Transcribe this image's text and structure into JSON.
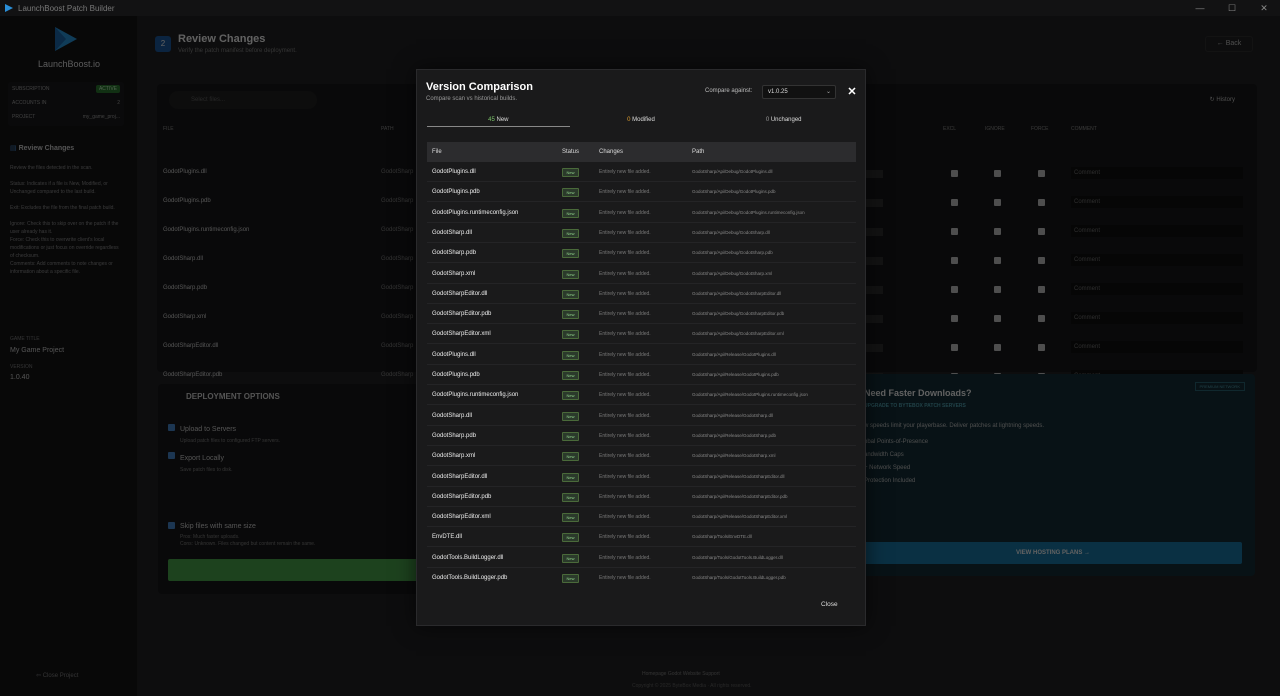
{
  "window": {
    "title": "LaunchBoost Patch Builder",
    "controls": [
      "—",
      "☐",
      "✕"
    ]
  },
  "sidebar": {
    "brand": "LaunchBoost.io",
    "subscription_label": "SUBSCRIPTION",
    "subscription_value": "ACTIVE",
    "accounts_label": "ACCOUNTS IN",
    "accounts_value": "2",
    "project_label": "PROJECT",
    "project_value": "my_game_proj...",
    "section": "Review Changes",
    "help_intro": "Review the files detected in the scan.",
    "help_status": "Status: Indicates if a file is New, Modified, or Unchanged compared to the last build.",
    "help_exit": "Exit: Excludes the file from the final patch build.",
    "help_ignore": "Ignore: Check this to skip over on the patch if the user already has it.",
    "help_force": "Force: Check this to overwrite client's local modifications or just focus on override regardless of checksum.",
    "help_comments": "Comments: Add comments to note changes or information about a specific file.",
    "game_title_label": "GAME TITLE",
    "game_title_value": "My Game Project",
    "version_label": "VERSION",
    "version_value": "1.0.40",
    "close_project": "Close Project"
  },
  "header": {
    "step": "2",
    "title": "Review Changes",
    "subtitle": "Verify the patch manifest before deployment.",
    "back": "Back"
  },
  "bg_table": {
    "search_placeholder": "Select files...",
    "history": "History",
    "col_file": "FILE",
    "col_path": "PATH",
    "col_excl": "EXCL",
    "col_ignore": "IGNORE",
    "col_force": "FORCE",
    "col_comment": "COMMENT",
    "comment_placeholder": "Comment",
    "rows": [
      {
        "file": "GodotPlugins.dll",
        "path": "GodotSharp"
      },
      {
        "file": "GodotPlugins.pdb",
        "path": "GodotSharp"
      },
      {
        "file": "GodotPlugins.runtimeconfig.json",
        "path": "GodotSharp"
      },
      {
        "file": "GodotSharp.dll",
        "path": "GodotSharp"
      },
      {
        "file": "GodotSharp.pdb",
        "path": "GodotSharp"
      },
      {
        "file": "GodotSharp.xml",
        "path": "GodotSharp"
      },
      {
        "file": "GodotSharpEditor.dll",
        "path": "GodotSharp"
      },
      {
        "file": "GodotSharpEditor.pdb",
        "path": "GodotSharp"
      }
    ]
  },
  "deploy": {
    "title": "DEPLOYMENT OPTIONS",
    "upload": "Upload to Servers",
    "upload_sub": "Upload patch files to configured FTP servers.",
    "export": "Export Locally",
    "export_sub": "Save patch files to disk.",
    "skip": "Skip files with same size",
    "skip_pros": "Pros: Much faster uploads.",
    "skip_cons": "Cons: Unknown. Files changed but content remain the same."
  },
  "promo": {
    "tag": "PREMIUM NETWORK",
    "title": "Need Faster Downloads?",
    "subtitle": "UPGRADE TO BYTEBOX PATCH SERVERS",
    "desc": "w speeds limit your playerbase. Deliver patches at lightning speeds.",
    "features": [
      "obal Points-of-Presence",
      "andwidth Caps",
      "+ Network Speed",
      "Protection Included"
    ],
    "button": "VIEW HOSTING PLANS"
  },
  "footer": {
    "links": "Homepage     Godot Website     Support",
    "copyright": "Copyright © 2025 ByteBox Media  ·  All rights reserved."
  },
  "modal": {
    "title": "Version Comparison",
    "subtitle": "Compare scan vs historical builds.",
    "compare_label": "Compare against:",
    "compare_value": "v1.0.25",
    "stats": {
      "new_count": "45",
      "new_label": "New",
      "mod_count": "0",
      "mod_label": "Modified",
      "unc_count": "0",
      "unc_label": "Unchanged"
    },
    "columns": {
      "file": "File",
      "status": "Status",
      "changes": "Changes",
      "path": "Path"
    },
    "close": "Close",
    "rows": [
      {
        "file": "GodotPlugins.dll",
        "status": "New",
        "changes": "Entirely new file added.",
        "path": "GodotSharp/Api/Debug/GodotPlugins.dll"
      },
      {
        "file": "GodotPlugins.pdb",
        "status": "New",
        "changes": "Entirely new file added.",
        "path": "GodotSharp/Api/Debug/GodotPlugins.pdb"
      },
      {
        "file": "GodotPlugins.runtimeconfig.json",
        "status": "New",
        "changes": "Entirely new file added.",
        "path": "GodotSharp/Api/Debug/GodotPlugins.runtimeconfig.json"
      },
      {
        "file": "GodotSharp.dll",
        "status": "New",
        "changes": "Entirely new file added.",
        "path": "GodotSharp/Api/Debug/GodotSharp.dll"
      },
      {
        "file": "GodotSharp.pdb",
        "status": "New",
        "changes": "Entirely new file added.",
        "path": "GodotSharp/Api/Debug/GodotSharp.pdb"
      },
      {
        "file": "GodotSharp.xml",
        "status": "New",
        "changes": "Entirely new file added.",
        "path": "GodotSharp/Api/Debug/GodotSharp.xml"
      },
      {
        "file": "GodotSharpEditor.dll",
        "status": "New",
        "changes": "Entirely new file added.",
        "path": "GodotSharp/Api/Debug/GodotSharpEditor.dll"
      },
      {
        "file": "GodotSharpEditor.pdb",
        "status": "New",
        "changes": "Entirely new file added.",
        "path": "GodotSharp/Api/Debug/GodotSharpEditor.pdb"
      },
      {
        "file": "GodotSharpEditor.xml",
        "status": "New",
        "changes": "Entirely new file added.",
        "path": "GodotSharp/Api/Debug/GodotSharpEditor.xml"
      },
      {
        "file": "GodotPlugins.dll",
        "status": "New",
        "changes": "Entirely new file added.",
        "path": "GodotSharp/Api/Release/GodotPlugins.dll"
      },
      {
        "file": "GodotPlugins.pdb",
        "status": "New",
        "changes": "Entirely new file added.",
        "path": "GodotSharp/Api/Release/GodotPlugins.pdb"
      },
      {
        "file": "GodotPlugins.runtimeconfig.json",
        "status": "New",
        "changes": "Entirely new file added.",
        "path": "GodotSharp/Api/Release/GodotPlugins.runtimeconfig.json"
      },
      {
        "file": "GodotSharp.dll",
        "status": "New",
        "changes": "Entirely new file added.",
        "path": "GodotSharp/Api/Release/GodotSharp.dll"
      },
      {
        "file": "GodotSharp.pdb",
        "status": "New",
        "changes": "Entirely new file added.",
        "path": "GodotSharp/Api/Release/GodotSharp.pdb"
      },
      {
        "file": "GodotSharp.xml",
        "status": "New",
        "changes": "Entirely new file added.",
        "path": "GodotSharp/Api/Release/GodotSharp.xml"
      },
      {
        "file": "GodotSharpEditor.dll",
        "status": "New",
        "changes": "Entirely new file added.",
        "path": "GodotSharp/Api/Release/GodotSharpEditor.dll"
      },
      {
        "file": "GodotSharpEditor.pdb",
        "status": "New",
        "changes": "Entirely new file added.",
        "path": "GodotSharp/Api/Release/GodotSharpEditor.pdb"
      },
      {
        "file": "GodotSharpEditor.xml",
        "status": "New",
        "changes": "Entirely new file added.",
        "path": "GodotSharp/Api/Release/GodotSharpEditor.xml"
      },
      {
        "file": "EnvDTE.dll",
        "status": "New",
        "changes": "Entirely new file added.",
        "path": "GodotSharp/Tools/EnvDTE.dll"
      },
      {
        "file": "GodotTools.BuildLogger.dll",
        "status": "New",
        "changes": "Entirely new file added.",
        "path": "GodotSharp/Tools/GodotTools.BuildLogger.dll"
      },
      {
        "file": "GodotTools.BuildLogger.pdb",
        "status": "New",
        "changes": "Entirely new file added.",
        "path": "GodotSharp/Tools/GodotTools.BuildLogger.pdb"
      }
    ]
  },
  "colors": {
    "accent": "#1e5fa8",
    "new_green": "#7cc46a",
    "modified_orange": "#e0a030"
  }
}
